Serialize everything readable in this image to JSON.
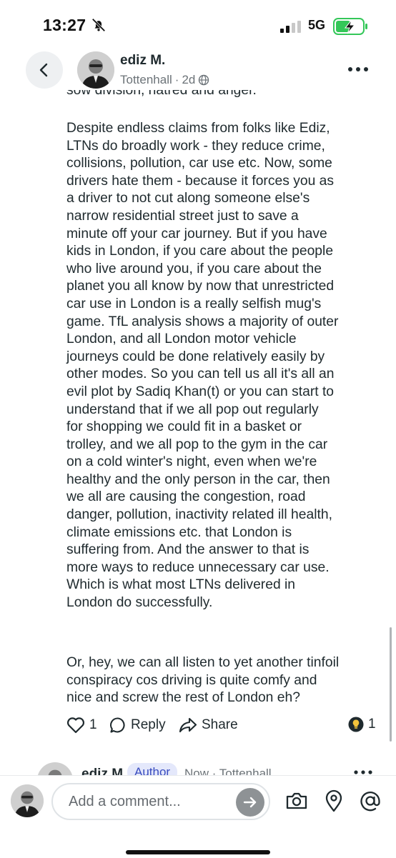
{
  "status_bar": {
    "time": "13:27",
    "network": "5G"
  },
  "post": {
    "author": "ediz M.",
    "location": "Tottenhall",
    "age": "2d",
    "clipped_first_line": "sow division, hatred and anger.",
    "paragraph_1": "Despite endless claims from folks like Ediz,\nLTNs do broadly work - they reduce crime,\ncollisions, pollution, car use etc. Now, some\ndrivers hate them - because it forces you as\na driver to not cut along someone else's\nnarrow residential street just to save a\nminute off your car journey. But if you have\nkids in London, if you care about the people\nwho live around you, if you care about the\nplanet you all know by now that unrestricted\ncar use in London is a really selfish mug's\ngame.  TfL analysis shows a majority of outer\nLondon, and all London motor vehicle\njourneys could be done relatively easily by\nother modes. So you can tell us all it's all an\nevil plot by Sadiq Khan(t) or you can start to\nunderstand that if we all pop out regularly\nfor shopping we could fit in a basket or\ntrolley, and we all pop to the gym in the car\non a cold winter's night, even when we're\nhealthy and the only person in the car, then\nwe all are causing the congestion, road\ndanger, pollution, inactivity related ill health,\nclimate emissions etc. that London is\nsuffering from. And the answer to that is\nmore ways to reduce unnecessary car use.\nWhich is what most LTNs delivered in\nLondon do successfully.",
    "paragraph_2": "Or, hey, we can all listen to yet another tinfoil\nconspiracy cos driving is quite comfy and\nnice and screw the rest of London eh?",
    "likes_count": "1",
    "reply_label": "Reply",
    "share_label": "Share",
    "reactions_count": "1"
  },
  "next_comment": {
    "author": "ediz M.",
    "badge": "Author",
    "meta": "Now · Tottenhall"
  },
  "composer": {
    "placeholder": "Add a comment..."
  },
  "colors": {
    "text": "#1f2a2e",
    "muted": "#6c7378",
    "send_button": "#8e9295",
    "battery": "#34c759"
  }
}
